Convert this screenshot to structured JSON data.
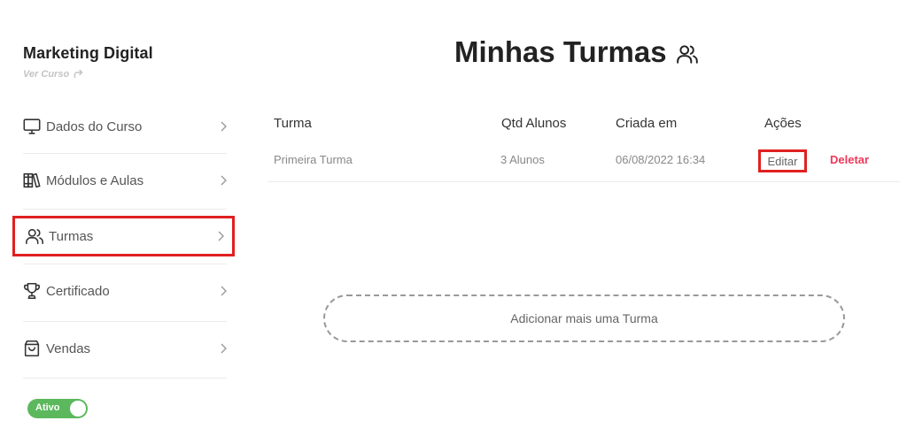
{
  "course": {
    "title": "Marketing Digital",
    "view_link": "Ver Curso"
  },
  "sidebar": {
    "items": [
      {
        "label": "Dados do Curso",
        "icon": "monitor-icon"
      },
      {
        "label": "Módulos e Aulas",
        "icon": "books-icon"
      },
      {
        "label": "Turmas",
        "icon": "users-icon",
        "active": true
      },
      {
        "label": "Certificado",
        "icon": "trophy-icon"
      },
      {
        "label": "Vendas",
        "icon": "shopping-bag-icon"
      }
    ],
    "status_toggle": {
      "label": "Ativo",
      "on": true
    }
  },
  "main": {
    "title": "Minhas Turmas",
    "table": {
      "headers": [
        "Turma",
        "Qtd Alunos",
        "Criada em",
        "Ações"
      ],
      "rows": [
        {
          "turma": "Primeira Turma",
          "qtd": "3 Alunos",
          "criada": "06/08/2022 16:34",
          "edit": "Editar",
          "delete": "Deletar"
        }
      ]
    },
    "add_button": "Adicionar mais uma Turma"
  },
  "colors": {
    "highlight": "#e02020",
    "delete": "#f0385a",
    "toggle": "#5cb85c"
  }
}
